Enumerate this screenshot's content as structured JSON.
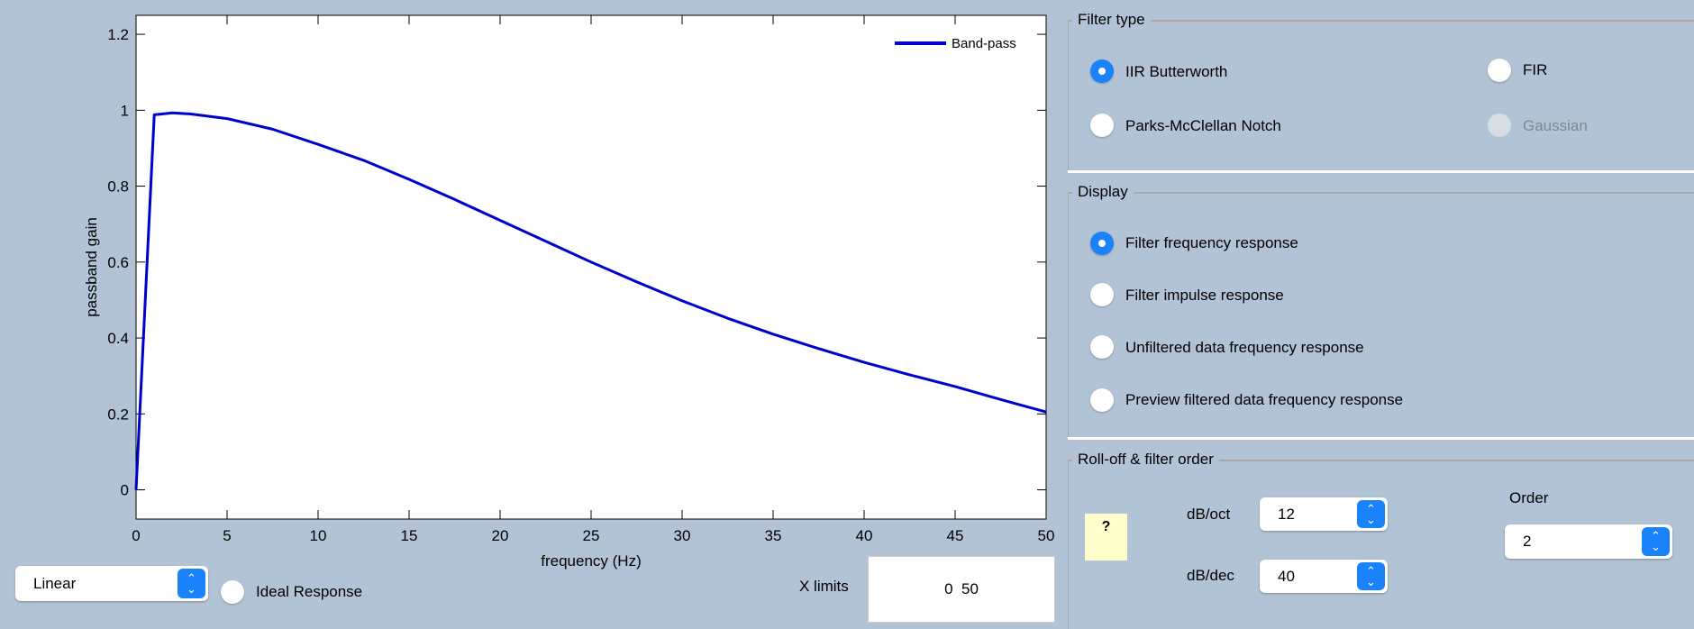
{
  "chart_data": {
    "type": "line",
    "xlabel": "frequency (Hz)",
    "ylabel": "passband gain",
    "xlim": [
      0,
      50
    ],
    "ylim": [
      -0.077,
      1.25
    ],
    "xticks": [
      0,
      5,
      10,
      15,
      20,
      25,
      30,
      35,
      40,
      45,
      50
    ],
    "yticks": [
      0,
      0.2,
      0.4,
      0.6,
      0.8,
      1,
      1.2
    ],
    "ytick_labels": [
      "0",
      "0.2",
      "0.4",
      "0.6",
      "0.8",
      "1",
      "1.2"
    ],
    "legend_placement": "top-right",
    "grid": false,
    "series": [
      {
        "name": "Band-pass",
        "color": "#0000cc",
        "x": [
          0,
          1,
          2,
          3,
          5,
          7.5,
          10,
          12.5,
          15,
          17.5,
          20,
          22.5,
          25,
          27.5,
          30,
          32.5,
          35,
          37.5,
          40,
          42.5,
          45,
          47.5,
          50
        ],
        "y": [
          0,
          0.988,
          0.993,
          0.99,
          0.978,
          0.95,
          0.91,
          0.868,
          0.818,
          0.765,
          0.71,
          0.655,
          0.6,
          0.548,
          0.498,
          0.452,
          0.41,
          0.372,
          0.336,
          0.303,
          0.272,
          0.238,
          0.205
        ]
      }
    ]
  },
  "controls": {
    "scale_select": "Linear",
    "ideal_response": "Ideal Response",
    "xlimits_label": "X limits",
    "xlimits_value": "0  50"
  },
  "filter_type": {
    "title": "Filter type",
    "options": [
      {
        "label": "IIR Butterworth",
        "selected": true,
        "enabled": true
      },
      {
        "label": "FIR",
        "selected": false,
        "enabled": true
      },
      {
        "label": "Parks-McClellan Notch",
        "selected": false,
        "enabled": true
      },
      {
        "label": "Gaussian",
        "selected": false,
        "enabled": false
      }
    ]
  },
  "display": {
    "title": "Display",
    "options": [
      {
        "label": "Filter frequency response",
        "selected": true
      },
      {
        "label": "Filter impulse response",
        "selected": false
      },
      {
        "label": "Unfiltered data frequency response",
        "selected": false
      },
      {
        "label": "Preview filtered data frequency response",
        "selected": false
      }
    ]
  },
  "rolloff": {
    "title": "Roll-off & filter order",
    "help": "?",
    "dboct_label": "dB/oct",
    "dboct_value": "12",
    "dbdec_label": "dB/dec",
    "dbdec_value": "40",
    "order_label": "Order",
    "order_value": "2"
  }
}
